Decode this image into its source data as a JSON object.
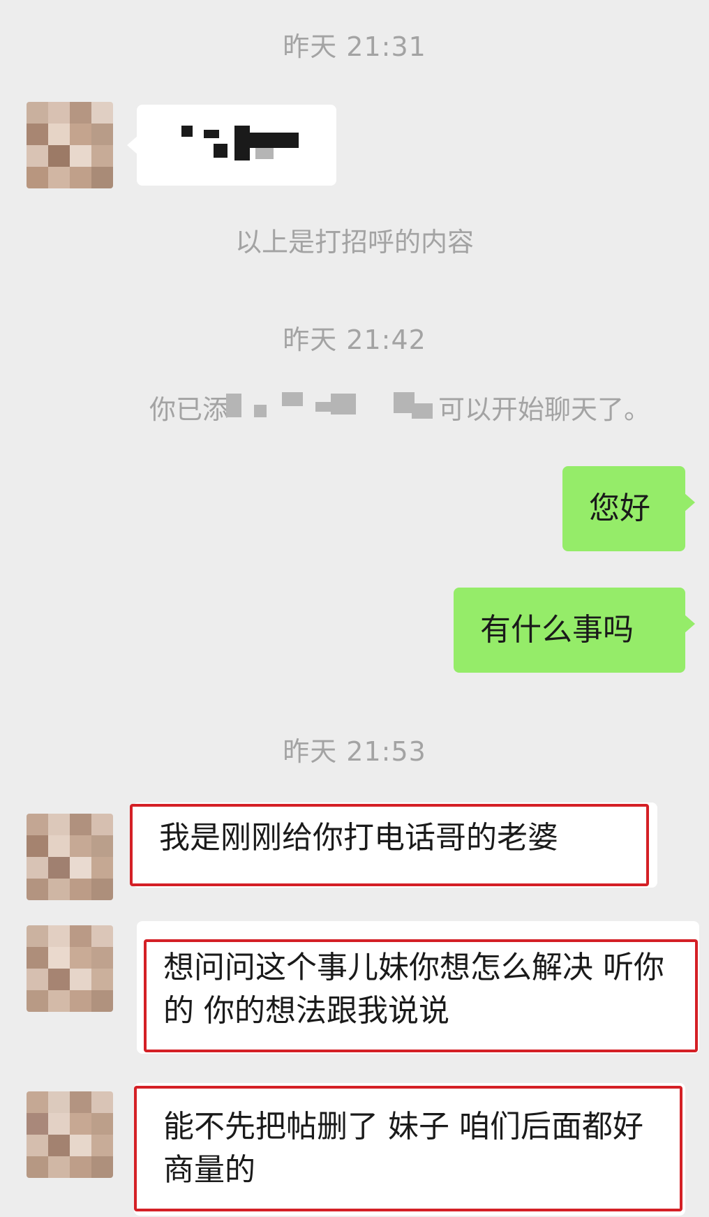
{
  "chat": {
    "timestamps": [
      "昨天 21:31",
      "昨天 21:42",
      "昨天 21:53"
    ],
    "system": {
      "greeting_note": "以上是打招呼的内容",
      "added_notice_prefix": "你已添",
      "added_notice_suffix": "可以开始聊天了。"
    },
    "messages": [
      {
        "side": "in",
        "text": "",
        "censored": true
      },
      {
        "side": "out",
        "text": "您好"
      },
      {
        "side": "out",
        "text": "有什么事吗"
      },
      {
        "side": "in",
        "text": "我是刚刚给你打电话哥的老婆",
        "highlighted": true
      },
      {
        "side": "in",
        "text": "想问问这个事儿妹你想怎么解决 听你的 你的想法跟我说说",
        "highlighted": true
      },
      {
        "side": "in",
        "text": "能不先把帖删了  妹子 咱们后面都好商量的",
        "highlighted": true
      }
    ],
    "colors": {
      "background": "#ededed",
      "outgoing_bubble": "#95ec69",
      "incoming_bubble": "#ffffff",
      "highlight_box": "#d42026",
      "meta_text": "#a3a3a3"
    }
  }
}
